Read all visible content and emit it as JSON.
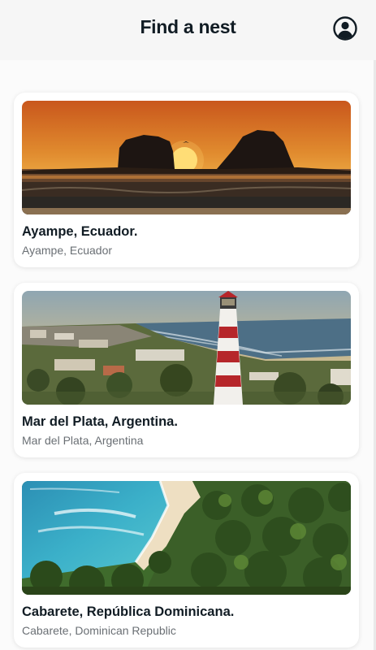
{
  "header": {
    "title": "Find a nest",
    "profile_icon": "account-circle-icon"
  },
  "listings": [
    {
      "name": "Ayampe, Ecuador.",
      "location": "Ayampe, Ecuador"
    },
    {
      "name": "Mar del Plata, Argentina.",
      "location": "Mar del Plata, Argentina"
    },
    {
      "name": "Cabarete, República Dominicana.",
      "location": "Cabarete, Dominican Republic"
    }
  ],
  "colors": {
    "title_text": "#111c24",
    "subtitle_text": "#6a6f74",
    "card_background": "#ffffff",
    "page_background": "#fbfbfb"
  }
}
